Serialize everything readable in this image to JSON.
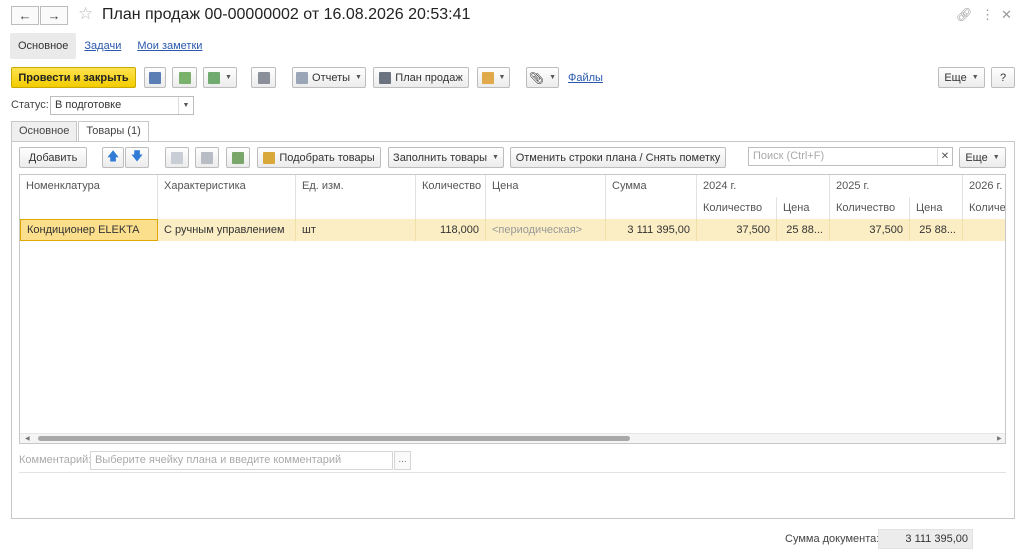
{
  "window": {
    "title": "План продаж 00-00000002 от 16.08.2026 20:53:41"
  },
  "form_tabs": [
    "Основное",
    "Задачи",
    "Мои заметки"
  ],
  "toolbar": {
    "post_close": "Провести и закрыть",
    "reports": "Отчеты",
    "sales_plan": "План продаж",
    "files": "Файлы",
    "more": "Еще",
    "help": "?"
  },
  "status": {
    "label": "Статус:",
    "value": "В подготовке"
  },
  "page_tabs": [
    "Основное",
    "Товары (1)"
  ],
  "goods_toolbar": {
    "add": "Добавить",
    "pick": "Подобрать товары",
    "fill": "Заполнить товары",
    "cancel_rows": "Отменить строки плана / Снять пометку",
    "search_placeholder": "Поиск (Ctrl+F)",
    "more": "Еще"
  },
  "table": {
    "headers": {
      "nomenclature": "Номенклатура",
      "characteristic": "Характеристика",
      "unit": "Ед. изм.",
      "quantity": "Количество",
      "price": "Цена",
      "sum": "Сумма",
      "y2024": "2024 г.",
      "y2025": "2025 г.",
      "y2026": "2026 г.",
      "sub_qty": "Количество",
      "sub_price": "Цена"
    },
    "rows": [
      {
        "nomenclature": "Кондиционер ELEKTA",
        "characteristic": "С ручным управлением",
        "unit": "шт",
        "quantity": "118,000",
        "price": "<периодическая>",
        "sum": "3 111 395,00",
        "qty_2024": "37,500",
        "price_2024": "25 88...",
        "qty_2025": "37,500",
        "price_2025": "25 88..."
      }
    ]
  },
  "comment": {
    "label": "Комментарий:",
    "placeholder": "Выберите ячейку плана и введите комментарий",
    "button": "..."
  },
  "footer": {
    "total_label": "Сумма документа:",
    "total_value": "3 111 395,00"
  }
}
